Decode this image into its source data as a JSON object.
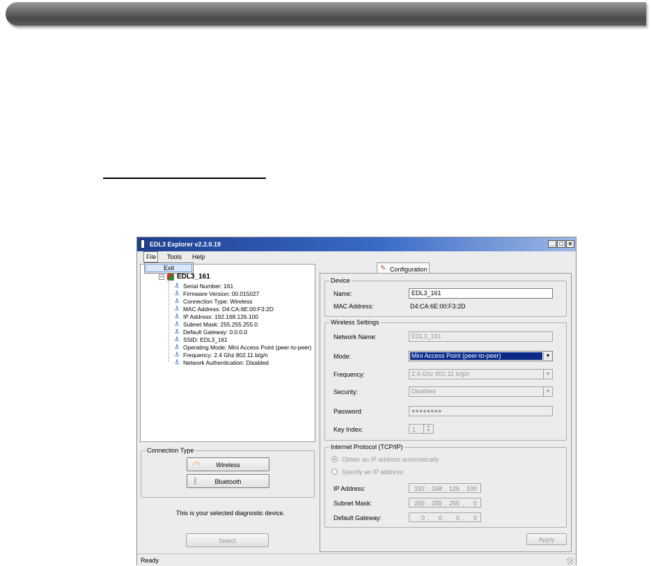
{
  "window": {
    "title": "EDL3 Explorer v2.2.0.19",
    "minimize": "_",
    "maximize": "□",
    "close": "×"
  },
  "menu": {
    "file": "File",
    "tools": "Tools",
    "help": "Help",
    "file_dropdown": {
      "exit": "Exit"
    }
  },
  "tree": {
    "root": "EDL3_161",
    "items": [
      "Serial Number: 161",
      "Firmware Version: 00.015027",
      "Connection Type: Wireless",
      "MAC Address: D4:CA:6E:00:F3:2D",
      "IP Address: 192.168.126.100",
      "Subnet Mask: 255.255.255.0",
      "Default Gateway: 0.0.0.0",
      "SSID: EDL3_161",
      "Operating Mode: Mini Access Point (peer-to-peer)",
      "Frequency: 2.4 Ghz 802.11 b/g/n",
      "Network Authentication: Disabled"
    ]
  },
  "connection": {
    "legend": "Connection Type",
    "wireless": "Wireless",
    "bluetooth": "Bluetooth",
    "message": "This is your selected diagnostic device.",
    "select": "Select"
  },
  "status": {
    "text": "Ready"
  },
  "config": {
    "tab": "Configuration",
    "device": {
      "legend": "Device",
      "name_label": "Name:",
      "name_value": "EDL3_161",
      "mac_label": "MAC Address:",
      "mac_value": "D4:CA:6E:00:F3:2D"
    },
    "wireless": {
      "legend": "Wireless Settings",
      "network_label": "Network Name:",
      "network_value": "EDL3_161",
      "mode_label": "Mode:",
      "mode_value": "Mini Access Point (peer-to-peer)",
      "frequency_label": "Frequency:",
      "frequency_value": "2.4 Ghz 802.11 b/g/n",
      "security_label": "Security:",
      "security_value": "Disabled",
      "password_label": "Password:",
      "password_value": "●●●●●●●●",
      "key_label": "Key Index:",
      "key_value": "1"
    },
    "ip": {
      "legend": "Internet Protocol (TCP/IP)",
      "auto": "Obtain an IP address automatically",
      "specify": "Specify an IP address:",
      "ip_label": "IP Address:",
      "ip_value": [
        "192",
        "168",
        "126",
        "100"
      ],
      "subnet_label": "Subnet Mask:",
      "subnet_value": [
        "255",
        "255",
        "255",
        "0"
      ],
      "gateway_label": "Default Gateway:",
      "gateway_value": [
        "0",
        "0",
        "0",
        "0"
      ]
    },
    "apply": "Apply"
  }
}
